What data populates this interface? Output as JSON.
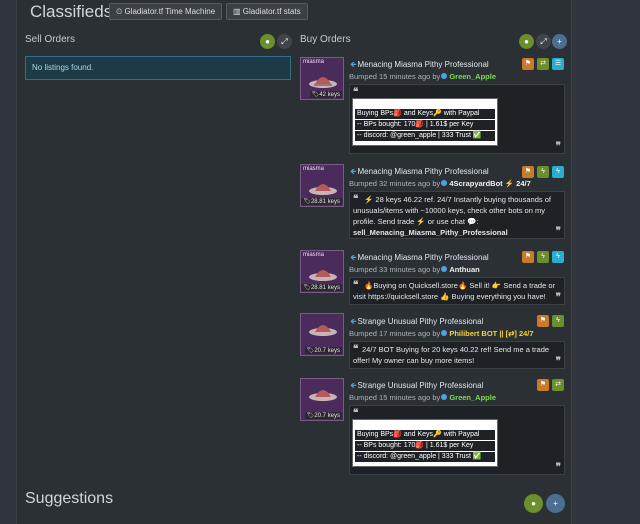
{
  "header": {
    "title": "Classifieds",
    "time_machine": "Gladiator.tf Time Machine",
    "stats": "Gladiator.tf stats"
  },
  "sell": {
    "title": "Sell Orders",
    "empty": "No listings found."
  },
  "buy": {
    "title": "Buy Orders"
  },
  "orders": [
    {
      "title": "Menacing Miasma Pithy Professional",
      "bumped": "Bumped 15 minutes ago by",
      "user": "Green_Apple",
      "price": "42 keys",
      "item_label": "miasma",
      "lines": [
        "Buying BPs🎒 and Keys🔑 with Paypal",
        "-- BPs bought: 170🎒 | 1.61$ per Key",
        "-- discord: @green_apple | 333 Trust ✅"
      ]
    },
    {
      "title": "Menacing Miasma Pithy Professional",
      "bumped": "Bumped 32 minutes ago by",
      "user": "4ScrapyardBot ⚡ 24/7",
      "price": "28.81 keys",
      "item_label": "miasma",
      "lines": [
        "⚡ 28 keys 46.22 ref. 24/7 Instantly buying thousands of",
        "unusuals/items with ~10000 keys, check other bots on my",
        "profile. Send  trade ⚡ or  use  chat 💬:",
        "sell_Menacing_Miasma_Pithy_Professional"
      ]
    },
    {
      "title": "Menacing Miasma Pithy Professional",
      "bumped": "Bumped 33 minutes ago by",
      "user": "Anthuan",
      "price": "28.81 keys",
      "item_label": "miasma",
      "lines": [
        "🔥Buying on Quicksell.store🔥 Sell it! 👉 Send a trade or",
        "visit https://quicksell.store 👍 Buying everything you have!"
      ]
    },
    {
      "title": "Strange Unusual Pithy Professional",
      "bumped": "Bumped 17 minutes ago by",
      "user": "Philibert BOT || [⇄] 24/7",
      "price": "20.7 keys",
      "item_label": "",
      "lines": [
        "24/7 BOT Buying for 20 keys 40.22 ref! Send me a trade",
        "offer! My owner can buy more items!"
      ]
    },
    {
      "title": "Strange Unusual Pithy Professional",
      "bumped": "Bumped 15 minutes ago by",
      "user": "Green_Apple",
      "price": "20.7 keys",
      "item_label": "",
      "lines": [
        "Buying BPs🎒 and Keys🔑 with Paypal",
        "-- BPs bought: 170🎒 | 1.61$ per Key",
        "-- discord: @green_apple | 333 Trust ✅"
      ]
    }
  ],
  "suggestions": {
    "title": "Suggestions"
  },
  "colors": {
    "bg": "#30363c",
    "panel": "#2b3035",
    "accent": "#4ba3e0",
    "item_bg": "#4b2a5c",
    "username": "#7ddc4d"
  }
}
